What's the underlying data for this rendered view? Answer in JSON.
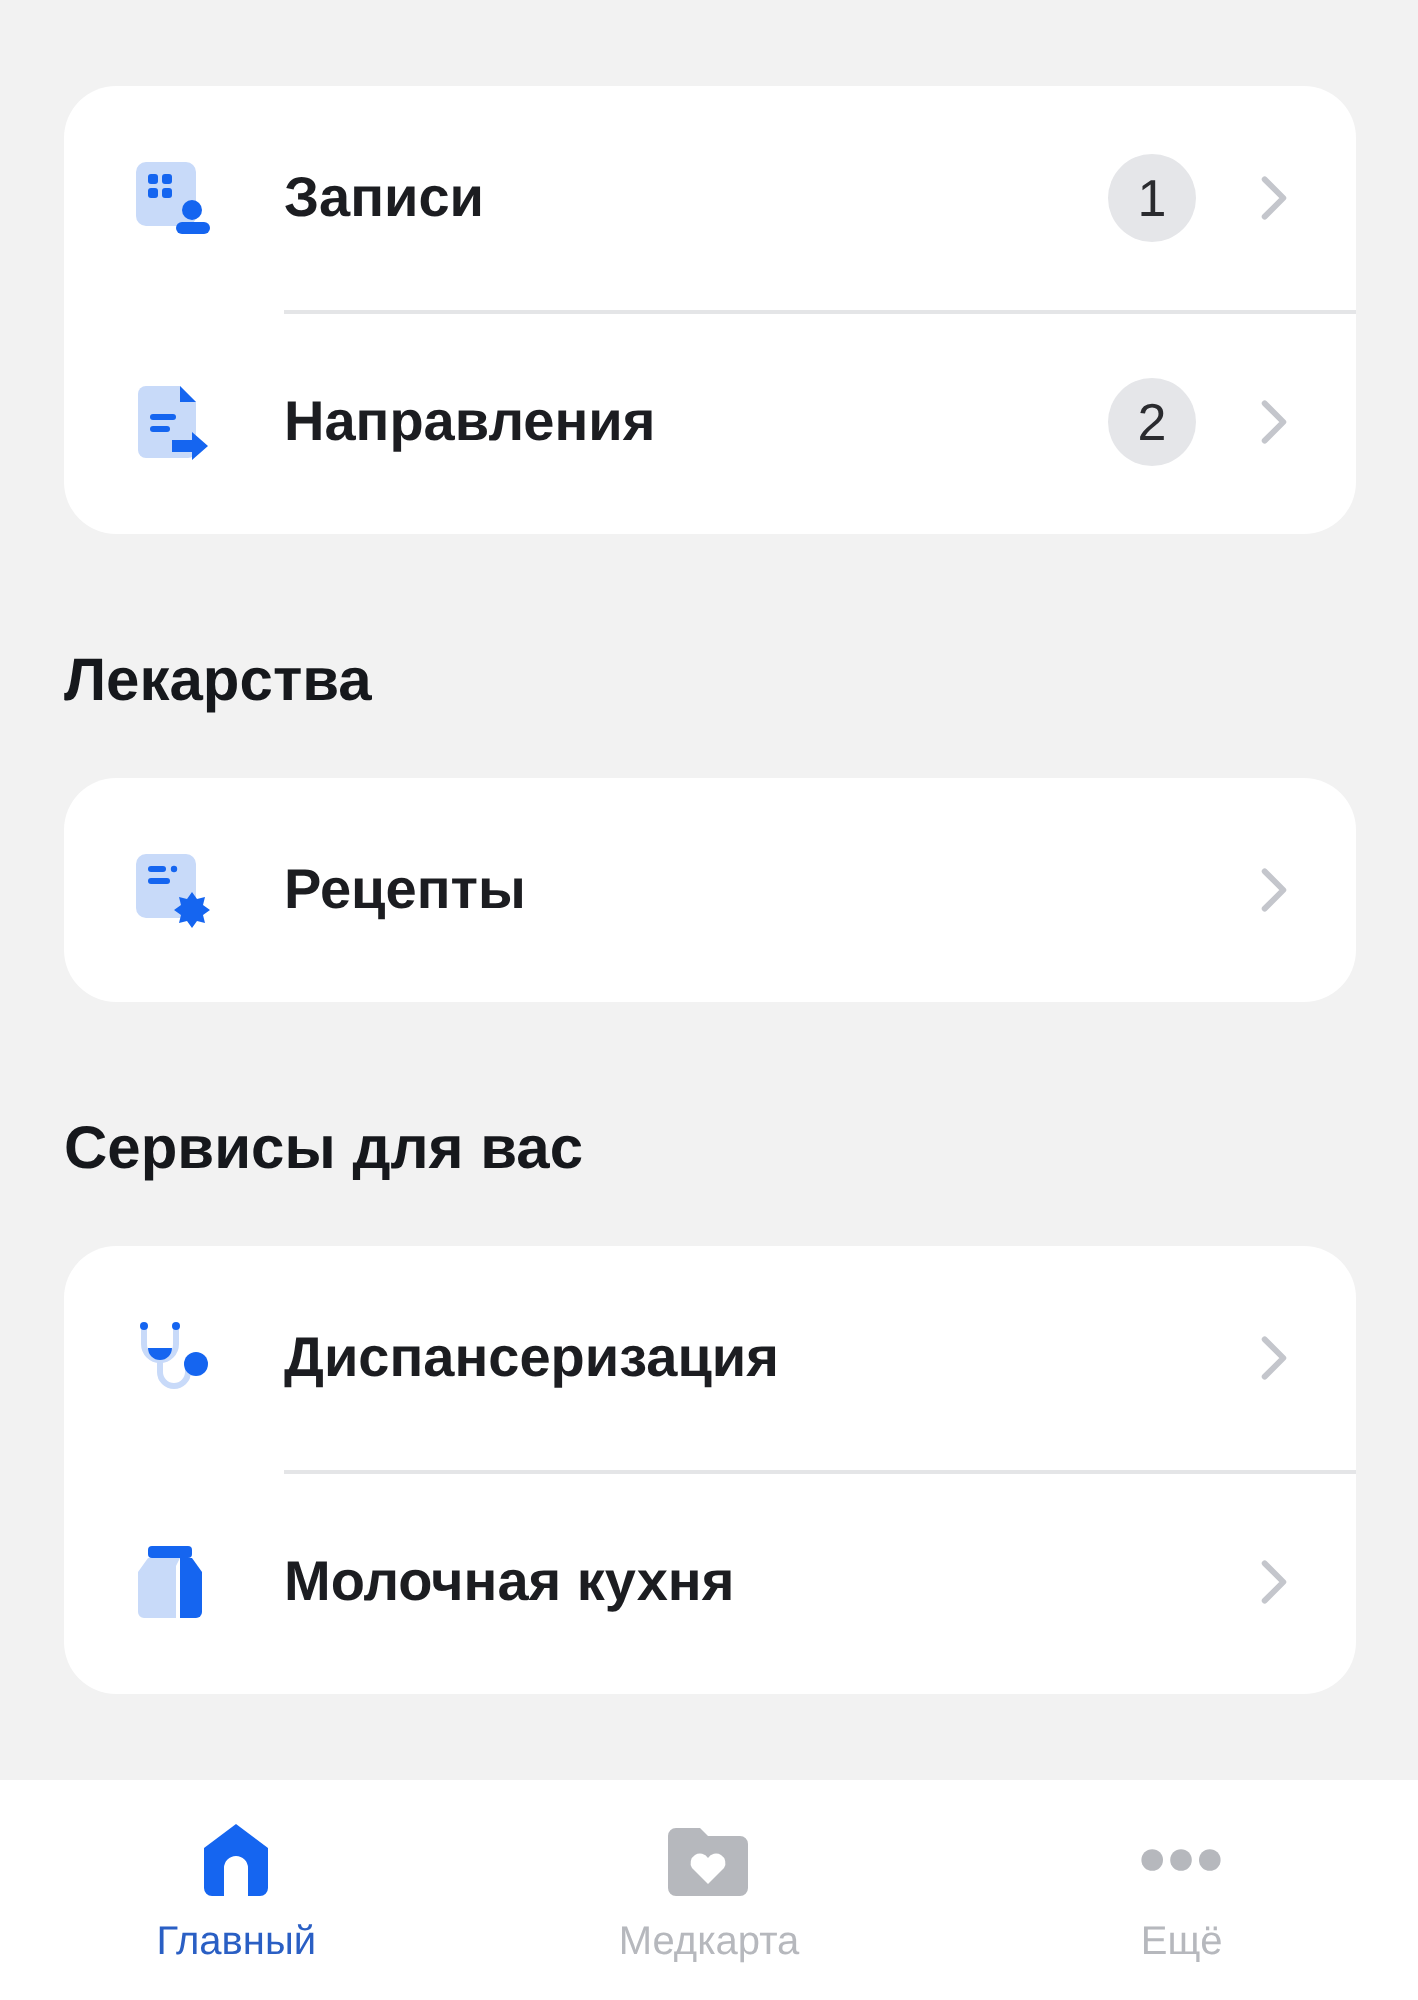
{
  "sections": [
    {
      "items": [
        {
          "kind": "records",
          "label": "Записи",
          "badge": "1"
        },
        {
          "kind": "referrals",
          "label": "Направления",
          "badge": "2"
        }
      ]
    },
    {
      "title": "Лекарства",
      "items": [
        {
          "kind": "prescriptions",
          "label": "Рецепты"
        }
      ]
    },
    {
      "title": "Сервисы для вас",
      "items": [
        {
          "kind": "checkup",
          "label": "Диспансеризация"
        },
        {
          "kind": "milk",
          "label": "Молочная кухня"
        }
      ]
    }
  ],
  "nav": [
    {
      "kind": "home",
      "label": "Главный",
      "selected": true
    },
    {
      "kind": "medcard",
      "label": "Медкарта",
      "selected": false
    },
    {
      "kind": "more",
      "label": "Ещё",
      "selected": false
    }
  ]
}
